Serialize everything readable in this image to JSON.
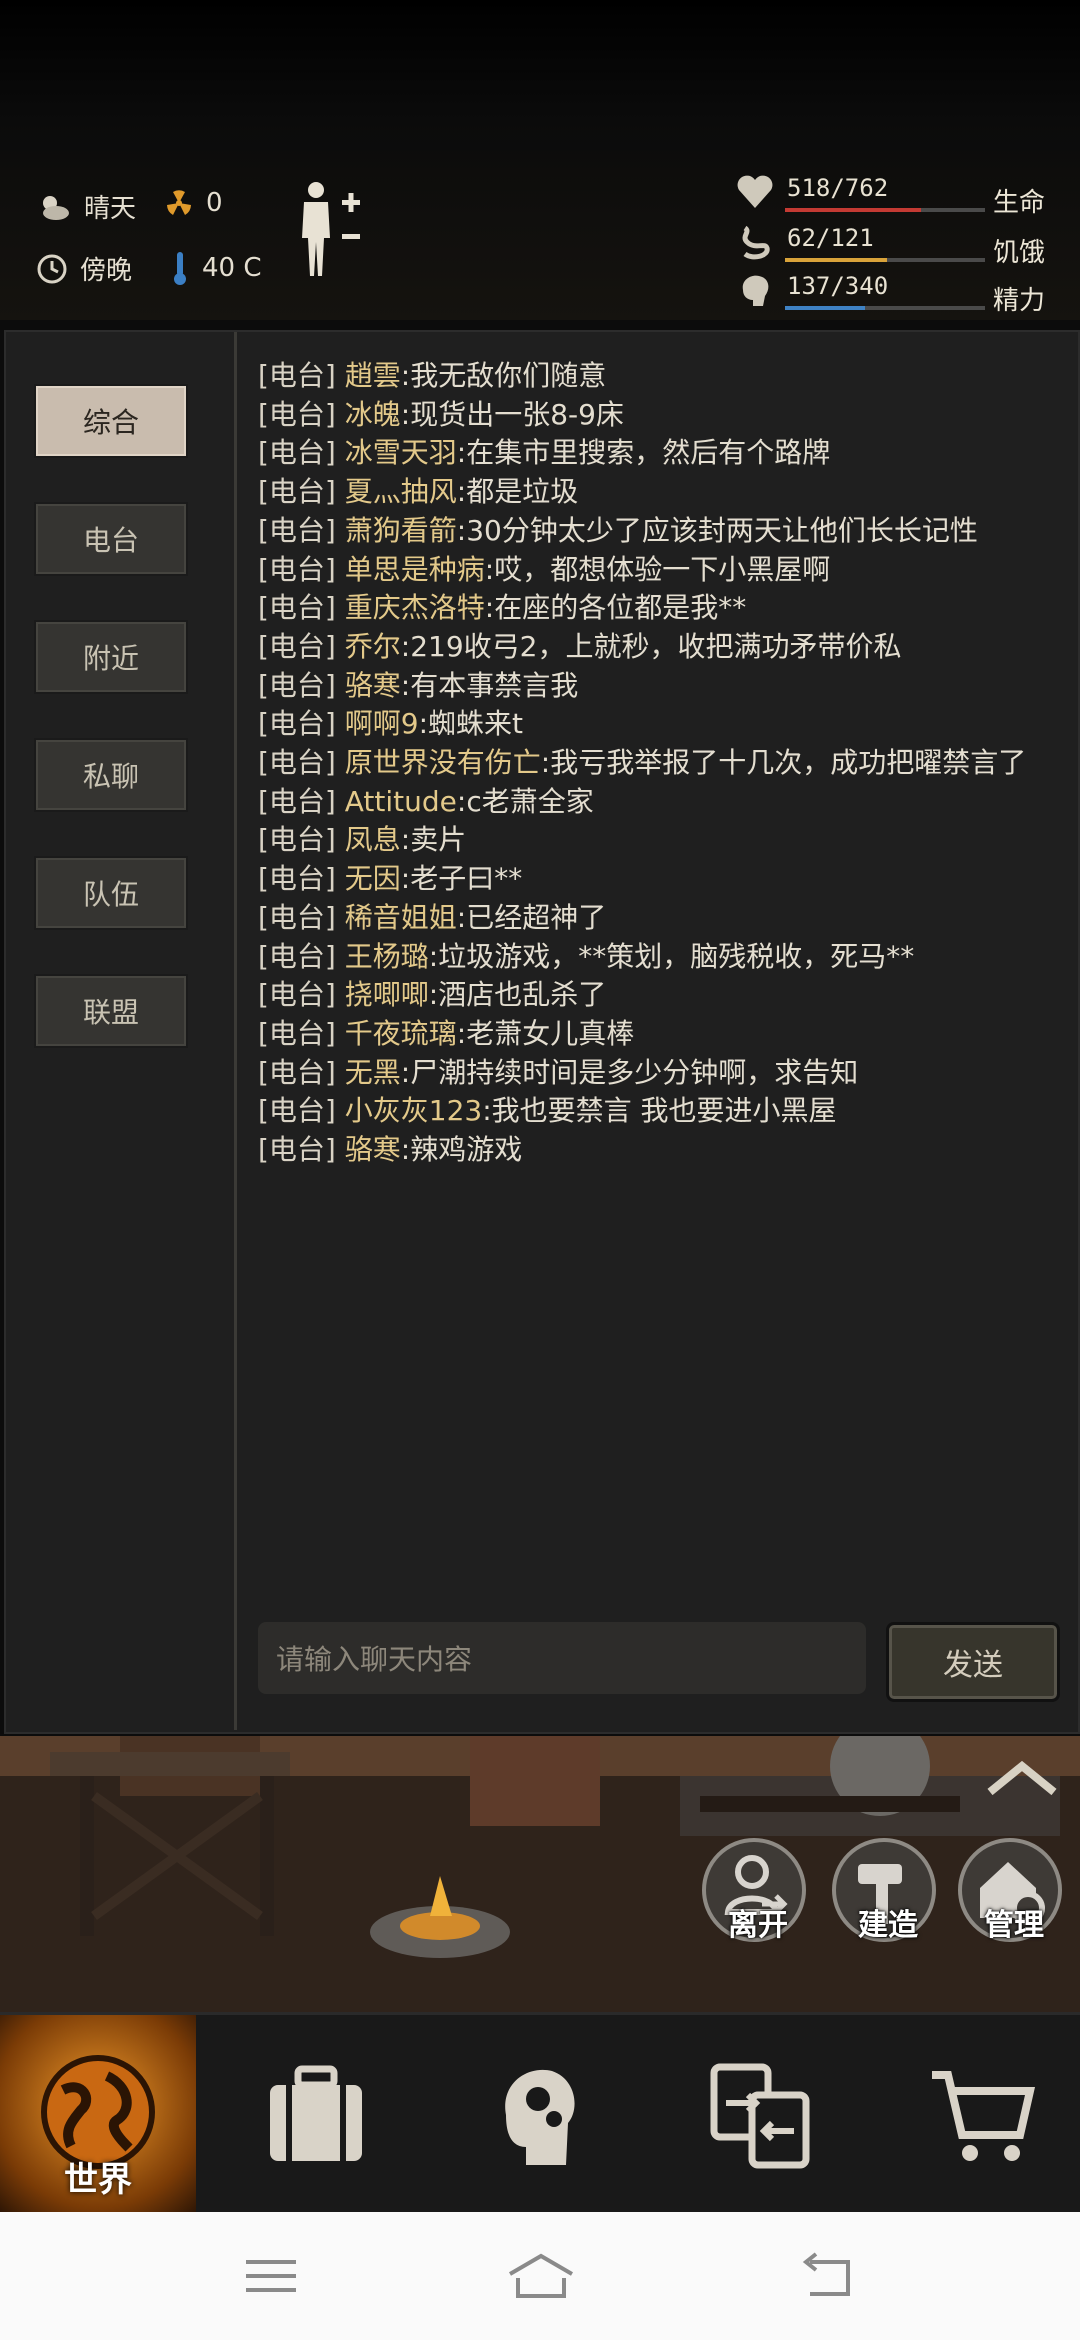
{
  "status": {
    "weather": "晴天",
    "radiation": "0",
    "time_of_day": "傍晚",
    "temperature": "40 C"
  },
  "vitals": [
    {
      "label": "生命",
      "value": "518/762",
      "fraction": 0.68,
      "color": "#c43a33",
      "icon": "heart-icon"
    },
    {
      "label": "饥饿",
      "value": "62/121",
      "fraction": 0.51,
      "color": "#d9a33a",
      "icon": "stomach-icon"
    },
    {
      "label": "精力",
      "value": "137/340",
      "fraction": 0.4,
      "color": "#3f82c4",
      "icon": "brain-icon"
    }
  ],
  "tabs": [
    "综合",
    "电台",
    "附近",
    "私聊",
    "队伍",
    "联盟"
  ],
  "active_tab": "综合",
  "messages": [
    {
      "channel": "[电台]",
      "user": "趙雲",
      "text": "我无敌你们随意"
    },
    {
      "channel": "[电台]",
      "user": "冰魄",
      "text": "现货出一张8-9床"
    },
    {
      "channel": "[电台]",
      "user": "冰雪天羽",
      "text": "在集市里搜索，然后有个路牌"
    },
    {
      "channel": "[电台]",
      "user": "夏灬抽风",
      "text": "都是垃圾"
    },
    {
      "channel": "[电台]",
      "user": "萧狗看箭",
      "text": "30分钟太少了应该封两天让他们长长记性"
    },
    {
      "channel": "[电台]",
      "user": "单思是种病",
      "text": "哎，都想体验一下小黑屋啊"
    },
    {
      "channel": "[电台]",
      "user": "重庆杰洛特",
      "text": "在座的各位都是我**"
    },
    {
      "channel": "[电台]",
      "user": "乔尔",
      "text": "219收弓2，上就秒，收把满功矛带价私"
    },
    {
      "channel": "[电台]",
      "user": "骆寒",
      "text": "有本事禁言我"
    },
    {
      "channel": "[电台]",
      "user": "啊啊9",
      "text": "蜘蛛来t"
    },
    {
      "channel": "[电台]",
      "user": "原世界没有伤亡",
      "text": "我亏我举报了十几次，成功把曜禁言了"
    },
    {
      "channel": "[电台]",
      "user": "Attitude",
      "text": "c老萧全家"
    },
    {
      "channel": "[电台]",
      "user": "凤息",
      "text": "卖片"
    },
    {
      "channel": "[电台]",
      "user": "无因",
      "text": "老子曰**"
    },
    {
      "channel": "[电台]",
      "user": "稀音姐姐",
      "text": "已经超神了"
    },
    {
      "channel": "[电台]",
      "user": "王杨璐",
      "text": "垃圾游戏，**策划，脑残税收，死马**"
    },
    {
      "channel": "[电台]",
      "user": "挠唧唧",
      "text": "酒店也乱杀了"
    },
    {
      "channel": "[电台]",
      "user": "千夜琉璃",
      "text": "老萧女儿真棒"
    },
    {
      "channel": "[电台]",
      "user": "无黑",
      "text": "尸潮持续时间是多少分钟啊，求告知"
    },
    {
      "channel": "[电台]",
      "user": "小灰灰123",
      "text": "我也要禁言 我也要进小黑屋"
    },
    {
      "channel": "[电台]",
      "user": "骆寒",
      "text": "辣鸡游戏"
    }
  ],
  "chat_input": {
    "placeholder": "请输入聊天内容",
    "send_label": "发送"
  },
  "actions": [
    {
      "label": "离开",
      "icon": "leave-icon"
    },
    {
      "label": "建造",
      "icon": "hammer-icon"
    },
    {
      "label": "管理",
      "icon": "home-gear-icon"
    }
  ],
  "nav": [
    {
      "label": "世界",
      "icon": "globe-icon"
    },
    {
      "label": "",
      "icon": "suitcase-icon"
    },
    {
      "label": "",
      "icon": "head-gears-icon"
    },
    {
      "label": "",
      "icon": "exchange-icon"
    },
    {
      "label": "",
      "icon": "cart-icon"
    }
  ]
}
